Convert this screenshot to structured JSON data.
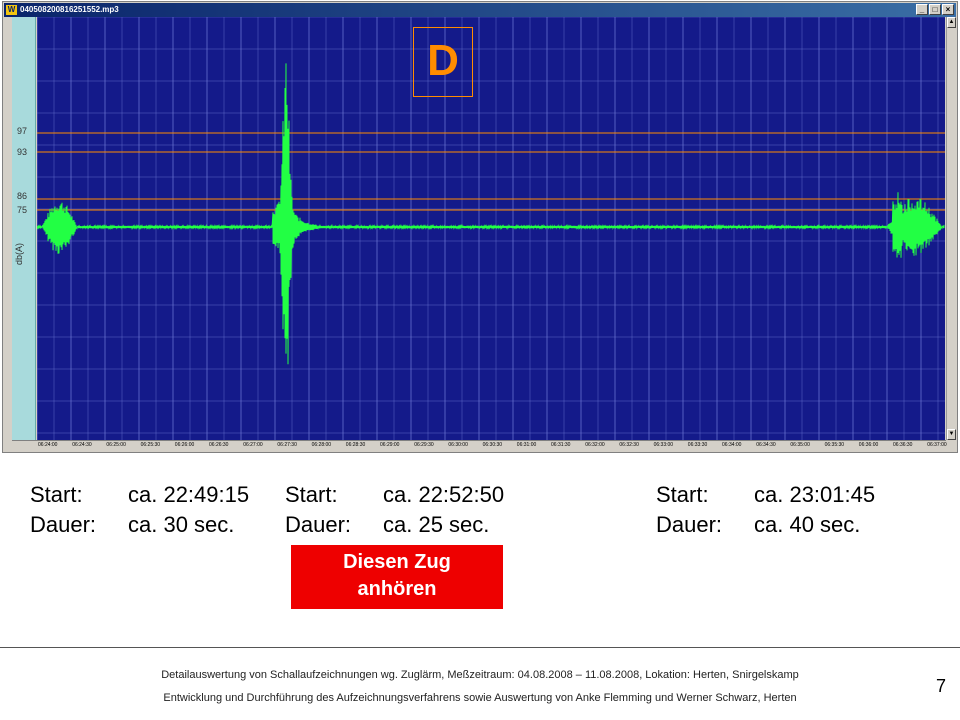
{
  "window": {
    "title": "040508200816251552.mp3",
    "app_icon": "W",
    "buttons": [
      {
        "name": "minimize-button",
        "glyph": "_"
      },
      {
        "name": "maximize-button",
        "glyph": "□"
      },
      {
        "name": "close-button",
        "glyph": "×"
      }
    ]
  },
  "colors": {
    "plot_background": "#141a8a",
    "grid": "#6f7bd6",
    "waveform": "#22ff44",
    "threshold_lines": "#ff8c00",
    "db_strip": "#a8dadc",
    "listen_button": "#ee0000"
  },
  "level_scale": {
    "unit": "db(A)",
    "ticks": [
      "97",
      "93",
      "86",
      "75"
    ]
  },
  "marker_label": "D",
  "timeline": {
    "ticks": [
      "06:24:00",
      "06:24:30",
      "06:25:00",
      "06:25:30",
      "06:26:00",
      "06:26:30",
      "06:27:00",
      "06:27:30",
      "06:28:00",
      "06:28:30",
      "06:29:00",
      "06:29:30",
      "06:30:00",
      "06:30:30",
      "06:31:00",
      "06:31:30",
      "06:32:00",
      "06:32:30",
      "06:33:00",
      "06:33:30",
      "06:34:00",
      "06:34:30",
      "06:35:00",
      "06:35:30",
      "06:36:00",
      "06:36:30",
      "06:37:00"
    ]
  },
  "events": [
    {
      "start_label": "Start:",
      "start_value": "ca. 22:49:15",
      "duration_label": "Dauer:",
      "duration_value": "ca. 30 sec."
    },
    {
      "start_label": "Start:",
      "start_value": "ca. 22:52:50",
      "duration_label": "Dauer:",
      "duration_value": "ca. 25 sec."
    },
    {
      "start_label": "Start:",
      "start_value": "ca. 23:01:45",
      "duration_label": "Dauer:",
      "duration_value": "ca. 40 sec."
    }
  ],
  "listen_button": {
    "line1": "Diesen Zug",
    "line2": "anhören"
  },
  "footer": {
    "line1": "Detailauswertung von Schallaufzeichnungen wg. Zuglärm, Meßzeitraum: 04.08.2008 – 11.08.2008, Lokation: Herten, Snirgelskamp",
    "line2": "Entwicklung und Durchführung des Aufzeichnungsverfahrens sowie Auswertung von Anke Flemming und Werner Schwarz, Herten",
    "page_number": "7"
  }
}
